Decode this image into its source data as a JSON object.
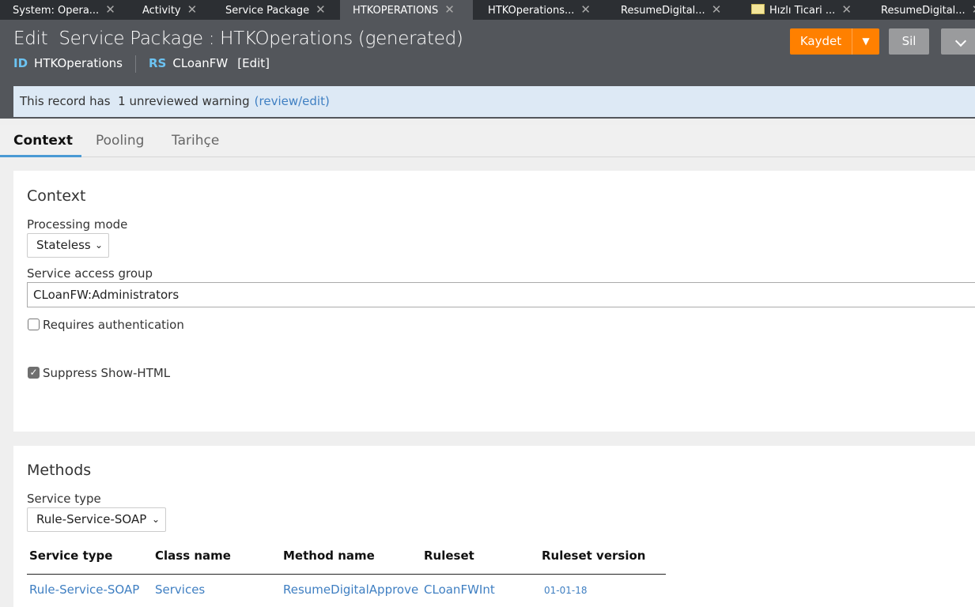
{
  "window_tabs": [
    {
      "label": "System: Opera..."
    },
    {
      "label": "Activity"
    },
    {
      "label": "Service Package"
    },
    {
      "label": "HTKOPERATIONS",
      "active": true
    },
    {
      "label": "HTKOperations..."
    },
    {
      "label": "ResumeDigital..."
    },
    {
      "label": "Hızlı Ticari ...",
      "icon": "folder-icon"
    },
    {
      "label": "ResumeDigital..."
    }
  ],
  "header": {
    "title": "Edit  Service Package : HTKOperations (generated)",
    "id_label": "ID",
    "id_value": "HTKOperations",
    "rs_label": "RS",
    "rs_value": "CLoanFW",
    "edit_link": "[Edit]",
    "save_label": "Kaydet",
    "delete_label": "Sil",
    "accent": "#ff8000"
  },
  "warning": {
    "text": "This record has  1 unreviewed warning",
    "link": "(review/edit)"
  },
  "tabs": [
    {
      "label": "Context",
      "active": true
    },
    {
      "label": "Pooling"
    },
    {
      "label": "Tarihçe"
    }
  ],
  "context": {
    "heading": "Context",
    "processing_mode_label": "Processing mode",
    "processing_mode_value": "Stateless",
    "access_group_label": "Service access group",
    "access_group_value": "CLoanFW:Administrators",
    "requires_auth_label": "Requires authentication",
    "requires_auth": false,
    "suppress_label": "Suppress Show-HTML",
    "suppress": true
  },
  "methods": {
    "heading": "Methods",
    "service_type_label": "Service type",
    "service_type_value": "Rule-Service-SOAP",
    "columns": [
      "Service type",
      "Class name",
      "Method name",
      "Ruleset",
      "Ruleset version"
    ],
    "rows": [
      [
        "Rule-Service-SOAP",
        "Services",
        "ResumeDigitalApprove",
        "CLoanFWInt",
        "01-01-18"
      ]
    ]
  }
}
